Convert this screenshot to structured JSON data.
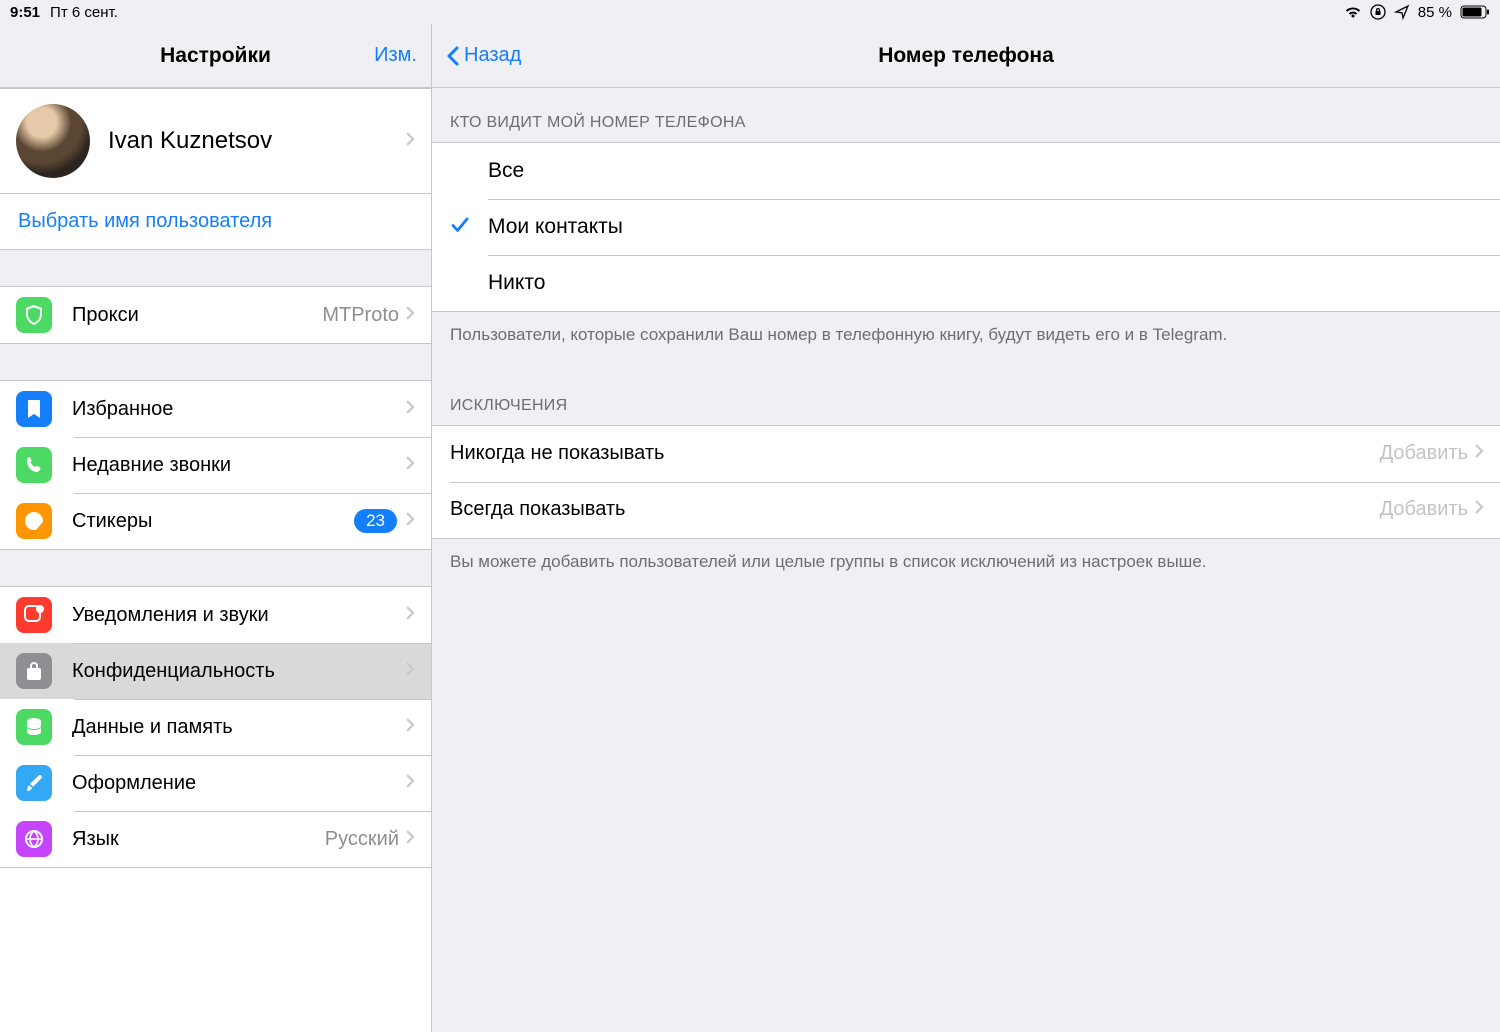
{
  "status": {
    "time": "9:51",
    "date": "Пт 6 сент.",
    "battery": "85 %"
  },
  "left": {
    "title": "Настройки",
    "edit": "Изм.",
    "profile_name": "Ivan Kuznetsov",
    "choose_username": "Выбрать имя пользователя",
    "proxy": {
      "label": "Прокси",
      "value": "MTProto"
    },
    "favorites": "Избранное",
    "recent_calls": "Недавние звонки",
    "stickers": {
      "label": "Стикеры",
      "badge": "23"
    },
    "notifications": "Уведомления и звуки",
    "privacy": "Конфиденциальность",
    "data": "Данные и память",
    "appearance": "Оформление",
    "language": {
      "label": "Язык",
      "value": "Русский"
    }
  },
  "right": {
    "back": "Назад",
    "title": "Номер телефона",
    "who_header": "КТО ВИДИТ МОЙ НОМЕР ТЕЛЕФОНА",
    "opt_all": "Все",
    "opt_contacts": "Мои контакты",
    "opt_nobody": "Никто",
    "who_footer": "Пользователи, которые сохранили Ваш номер в телефонную книгу, будут видеть его и в Telegram.",
    "exc_header": "ИСКЛЮЧЕНИЯ",
    "never": "Никогда не показывать",
    "always": "Всегда показывать",
    "add": "Добавить",
    "exc_footer": "Вы можете добавить пользователей или целые группы в список исключений из настроек выше."
  }
}
